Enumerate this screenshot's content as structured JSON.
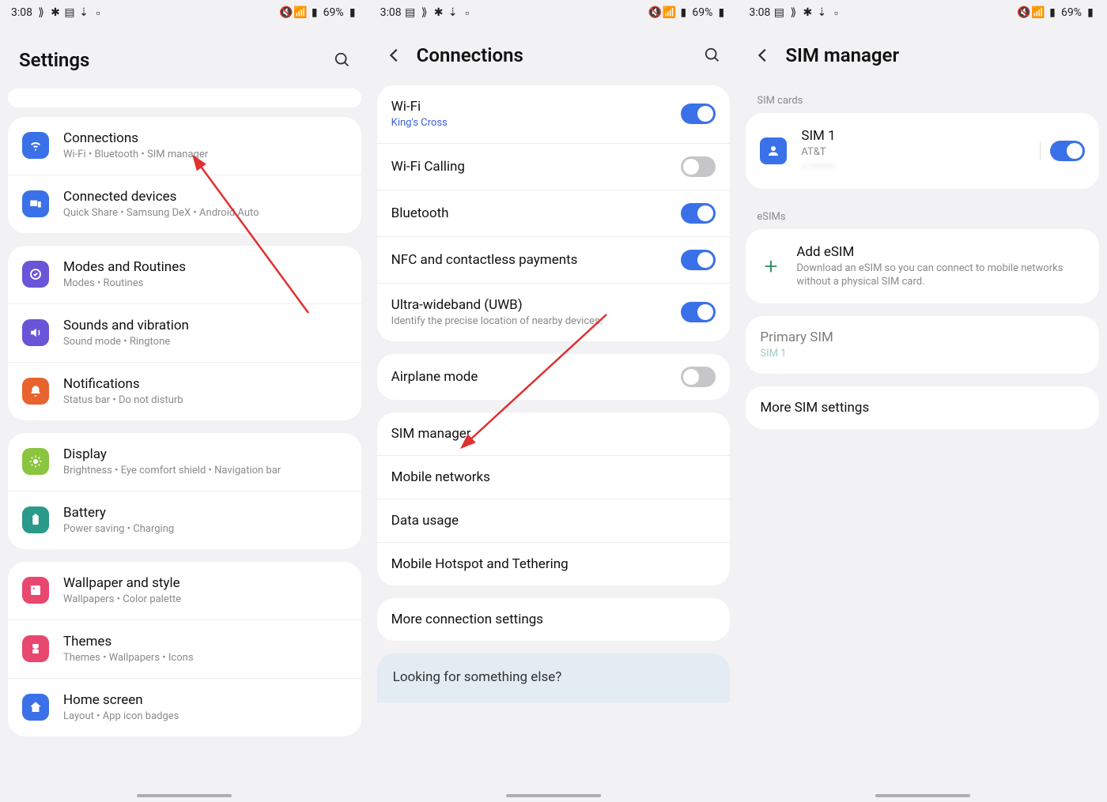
{
  "status": {
    "time": "3:08",
    "battery": "69%"
  },
  "screen1": {
    "title": "Settings",
    "groups": [
      [
        {
          "icon": "wifi",
          "color": "#3a71e8",
          "title": "Connections",
          "sub": "Wi-Fi  •  Bluetooth  •  SIM manager"
        },
        {
          "icon": "devices",
          "color": "#3a71e8",
          "title": "Connected devices",
          "sub": "Quick Share  •  Samsung DeX  •  Android Auto"
        }
      ],
      [
        {
          "icon": "modes",
          "color": "#6a55d8",
          "title": "Modes and Routines",
          "sub": "Modes  •  Routines"
        },
        {
          "icon": "sound",
          "color": "#6a55d8",
          "title": "Sounds and vibration",
          "sub": "Sound mode  •  Ringtone"
        },
        {
          "icon": "notif",
          "color": "#e8632e",
          "title": "Notifications",
          "sub": "Status bar  •  Do not disturb"
        }
      ],
      [
        {
          "icon": "display",
          "color": "#8bc540",
          "title": "Display",
          "sub": "Brightness  •  Eye comfort shield  •  Navigation bar"
        },
        {
          "icon": "battery",
          "color": "#2a9a8a",
          "title": "Battery",
          "sub": "Power saving  •  Charging"
        }
      ],
      [
        {
          "icon": "wallpaper",
          "color": "#e8476e",
          "title": "Wallpaper and style",
          "sub": "Wallpapers  •  Color palette"
        },
        {
          "icon": "themes",
          "color": "#e8476e",
          "title": "Themes",
          "sub": "Themes  •  Wallpapers  •  Icons"
        },
        {
          "icon": "home",
          "color": "#3a71e8",
          "title": "Home screen",
          "sub": "Layout  •  App icon badges"
        }
      ]
    ]
  },
  "screen2": {
    "title": "Connections",
    "group1": [
      {
        "title": "Wi-Fi",
        "sub": "King's Cross",
        "subClass": "blue",
        "toggle": "on"
      },
      {
        "title": "Wi-Fi Calling",
        "toggle": "off"
      },
      {
        "title": "Bluetooth",
        "toggle": "on"
      },
      {
        "title": "NFC and contactless payments",
        "toggle": "on"
      },
      {
        "title": "Ultra-wideband (UWB)",
        "sub": "Identify the precise location of nearby devices.",
        "toggle": "on"
      }
    ],
    "group2": [
      {
        "title": "Airplane mode",
        "toggle": "off"
      }
    ],
    "group3": [
      {
        "title": "SIM manager"
      },
      {
        "title": "Mobile networks"
      },
      {
        "title": "Data usage"
      },
      {
        "title": "Mobile Hotspot and Tethering"
      }
    ],
    "group4": [
      {
        "title": "More connection settings"
      }
    ],
    "looking": "Looking for something else?"
  },
  "screen3": {
    "title": "SIM manager",
    "simcards_label": "SIM cards",
    "sim1": {
      "title": "SIM 1",
      "sub": "AT&T",
      "toggle": "on"
    },
    "esims_label": "eSIMs",
    "addesim": {
      "title": "Add eSIM",
      "sub": "Download an eSIM so you can connect to mobile networks without a physical SIM card."
    },
    "primary": {
      "title": "Primary SIM",
      "sub": "SIM 1"
    },
    "more": "More SIM settings"
  }
}
